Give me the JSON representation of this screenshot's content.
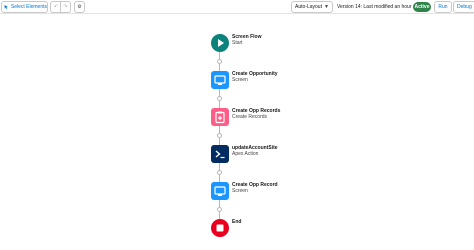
{
  "toolbar": {
    "select_label": "Select Elements",
    "layout_label": "Auto-Layout",
    "version_text": "Version 14: Last modified an hour ago",
    "status_badge": "Active",
    "run_label": "Run",
    "debug_label": "Debug"
  },
  "nodes": [
    {
      "title": "Screen Flow",
      "subtitle": "Start",
      "icon": "play-icon",
      "color": "#0b827c"
    },
    {
      "title": "Create Opportunity",
      "subtitle": "Screen",
      "icon": "screen-icon",
      "color": "#1b96ff"
    },
    {
      "title": "Create Opp Records",
      "subtitle": "Create Records",
      "icon": "record-create-icon",
      "color": "#ff5d87"
    },
    {
      "title": "updateAccountSite",
      "subtitle": "Apex Action",
      "icon": "apex-icon",
      "color": "#032d60"
    },
    {
      "title": "Create Opp Record",
      "subtitle": "Screen",
      "icon": "screen-icon",
      "color": "#1b96ff"
    },
    {
      "title": "End",
      "subtitle": "",
      "icon": "stop-icon",
      "color": "#ea001e"
    }
  ]
}
